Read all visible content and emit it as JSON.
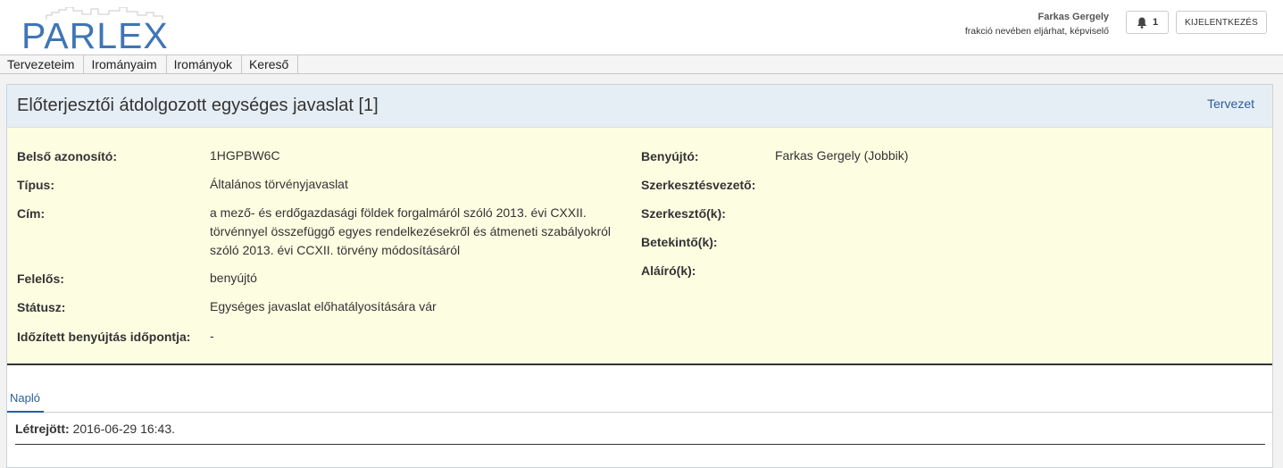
{
  "header": {
    "logo_text": "PARLEX",
    "user_name": "Farkas Gergely",
    "user_role": "frakció nevében eljárhat, képviselő",
    "notification_count": "1",
    "logout_label": "KIJELENTKEZÉS",
    "icons": {
      "notifications": "bell-icon"
    }
  },
  "nav": {
    "items": [
      "Tervezeteim",
      "Irományaim",
      "Irományok",
      "Kereső"
    ]
  },
  "panel": {
    "title": "Előterjesztői átdolgozott egységes javaslat [1]",
    "status": "Tervezet"
  },
  "details": {
    "left": [
      {
        "label": "Belső azonosító:",
        "value": "1HGPBW6C"
      },
      {
        "label": "Típus:",
        "value": "Általános törvényjavaslat"
      },
      {
        "label": "Cím:",
        "value": "a mező- és erdőgazdasági földek forgalmáról szóló 2013. évi CXXII. törvénnyel összefüggő egyes rendelkezésekről és átmeneti szabályokról szóló 2013. évi CCXII. törvény módosításáról"
      },
      {
        "label": "Felelős:",
        "value": "benyújtó"
      },
      {
        "label": "Státusz:",
        "value": "Egységes javaslat előhatályosítására vár"
      },
      {
        "label": "Időzített benyújtás időpontja:",
        "value": "-"
      }
    ],
    "right": [
      {
        "label": "Benyújtó:",
        "value": "Farkas Gergely (Jobbik)"
      },
      {
        "label": "Szerkesztésvezető:",
        "value": ""
      },
      {
        "label": "Szerkesztő(k):",
        "value": ""
      },
      {
        "label": "Betekintő(k):",
        "value": ""
      },
      {
        "label": "Aláíró(k):",
        "value": ""
      }
    ]
  },
  "tabs": {
    "active": "Napló"
  },
  "log": {
    "label": "Létrejött:",
    "value": "2016-06-29 16:43."
  }
}
